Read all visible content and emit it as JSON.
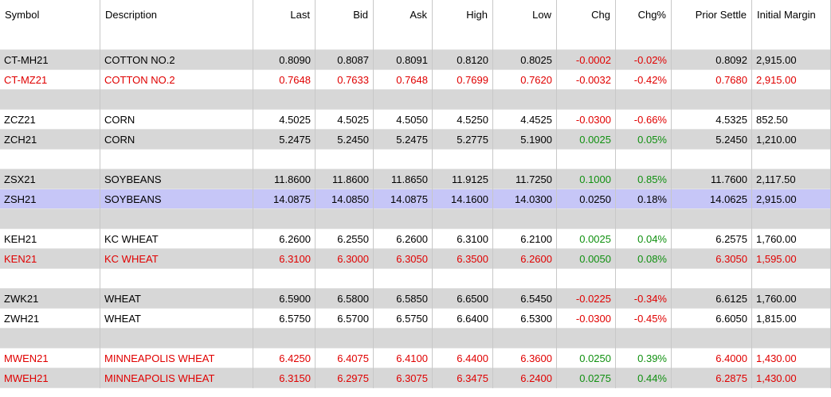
{
  "columns": [
    "Symbol",
    "Description",
    "Last",
    "Bid",
    "Ask",
    "High",
    "Low",
    "Chg",
    "Chg%",
    "Prior Settle",
    "Initial Margin"
  ],
  "rows": [
    {
      "blank": true,
      "bg": "white"
    },
    {
      "symbol": "CT-MH21",
      "description": "COTTON NO.2",
      "last": "0.8090",
      "bid": "0.8087",
      "ask": "0.8091",
      "high": "0.8120",
      "low": "0.8025",
      "chg": "-0.0002",
      "chg_pct": "-0.02%",
      "prior_settle": "0.8092",
      "initial_margin": "2,915.00",
      "text_color": "black",
      "chg_color": "red",
      "bg": "gray"
    },
    {
      "symbol": "CT-MZ21",
      "description": "COTTON NO.2",
      "last": "0.7648",
      "bid": "0.7633",
      "ask": "0.7648",
      "high": "0.7699",
      "low": "0.7620",
      "chg": "-0.0032",
      "chg_pct": "-0.42%",
      "prior_settle": "0.7680",
      "initial_margin": "2,915.00",
      "text_color": "red",
      "chg_color": "red",
      "bg": "white"
    },
    {
      "blank": true,
      "bg": "gray"
    },
    {
      "symbol": "ZCZ21",
      "description": "CORN",
      "last": "4.5025",
      "bid": "4.5025",
      "ask": "4.5050",
      "high": "4.5250",
      "low": "4.4525",
      "chg": "-0.0300",
      "chg_pct": "-0.66%",
      "prior_settle": "4.5325",
      "initial_margin": "852.50",
      "text_color": "black",
      "chg_color": "red",
      "bg": "white"
    },
    {
      "symbol": "ZCH21",
      "description": "CORN",
      "last": "5.2475",
      "bid": "5.2450",
      "ask": "5.2475",
      "high": "5.2775",
      "low": "5.1900",
      "chg": "0.0025",
      "chg_pct": "0.05%",
      "prior_settle": "5.2450",
      "initial_margin": "1,210.00",
      "text_color": "black",
      "chg_color": "green",
      "bg": "gray"
    },
    {
      "blank": true,
      "bg": "white"
    },
    {
      "symbol": "ZSX21",
      "description": "SOYBEANS",
      "last": "11.8600",
      "bid": "11.8600",
      "ask": "11.8650",
      "high": "11.9125",
      "low": "11.7250",
      "chg": "0.1000",
      "chg_pct": "0.85%",
      "prior_settle": "11.7600",
      "initial_margin": "2,117.50",
      "text_color": "black",
      "chg_color": "green",
      "bg": "gray"
    },
    {
      "symbol": "ZSH21",
      "description": "SOYBEANS",
      "last": "14.0875",
      "bid": "14.0850",
      "ask": "14.0875",
      "high": "14.1600",
      "low": "14.0300",
      "chg": "0.0250",
      "chg_pct": "0.18%",
      "prior_settle": "14.0625",
      "initial_margin": "2,915.00",
      "text_color": "black",
      "chg_color": "black",
      "bg": "selected"
    },
    {
      "blank": true,
      "bg": "gray"
    },
    {
      "symbol": "KEH21",
      "description": "KC WHEAT",
      "last": "6.2600",
      "bid": "6.2550",
      "ask": "6.2600",
      "high": "6.3100",
      "low": "6.2100",
      "chg": "0.0025",
      "chg_pct": "0.04%",
      "prior_settle": "6.2575",
      "initial_margin": "1,760.00",
      "text_color": "black",
      "chg_color": "green",
      "bg": "white"
    },
    {
      "symbol": "KEN21",
      "description": "KC WHEAT",
      "last": "6.3100",
      "bid": "6.3000",
      "ask": "6.3050",
      "high": "6.3500",
      "low": "6.2600",
      "chg": "0.0050",
      "chg_pct": "0.08%",
      "prior_settle": "6.3050",
      "initial_margin": "1,595.00",
      "text_color": "red",
      "chg_color": "green",
      "bg": "gray"
    },
    {
      "blank": true,
      "bg": "white"
    },
    {
      "symbol": "ZWK21",
      "description": "WHEAT",
      "last": "6.5900",
      "bid": "6.5800",
      "ask": "6.5850",
      "high": "6.6500",
      "low": "6.5450",
      "chg": "-0.0225",
      "chg_pct": "-0.34%",
      "prior_settle": "6.6125",
      "initial_margin": "1,760.00",
      "text_color": "black",
      "chg_color": "red",
      "bg": "gray"
    },
    {
      "symbol": "ZWH21",
      "description": "WHEAT",
      "last": "6.5750",
      "bid": "6.5700",
      "ask": "6.5750",
      "high": "6.6400",
      "low": "6.5300",
      "chg": "-0.0300",
      "chg_pct": "-0.45%",
      "prior_settle": "6.6050",
      "initial_margin": "1,815.00",
      "text_color": "black",
      "chg_color": "red",
      "bg": "white"
    },
    {
      "blank": true,
      "bg": "gray"
    },
    {
      "symbol": "MWEN21",
      "description": "MINNEAPOLIS WHEAT",
      "last": "6.4250",
      "bid": "6.4075",
      "ask": "6.4100",
      "high": "6.4400",
      "low": "6.3600",
      "chg": "0.0250",
      "chg_pct": "0.39%",
      "prior_settle": "6.4000",
      "initial_margin": "1,430.00",
      "text_color": "red",
      "chg_color": "green",
      "bg": "white"
    },
    {
      "symbol": "MWEH21",
      "description": "MINNEAPOLIS WHEAT",
      "last": "6.3150",
      "bid": "6.2975",
      "ask": "6.3075",
      "high": "6.3475",
      "low": "6.2400",
      "chg": "0.0275",
      "chg_pct": "0.44%",
      "prior_settle": "6.2875",
      "initial_margin": "1,430.00",
      "text_color": "red",
      "chg_color": "green",
      "bg": "gray"
    }
  ]
}
